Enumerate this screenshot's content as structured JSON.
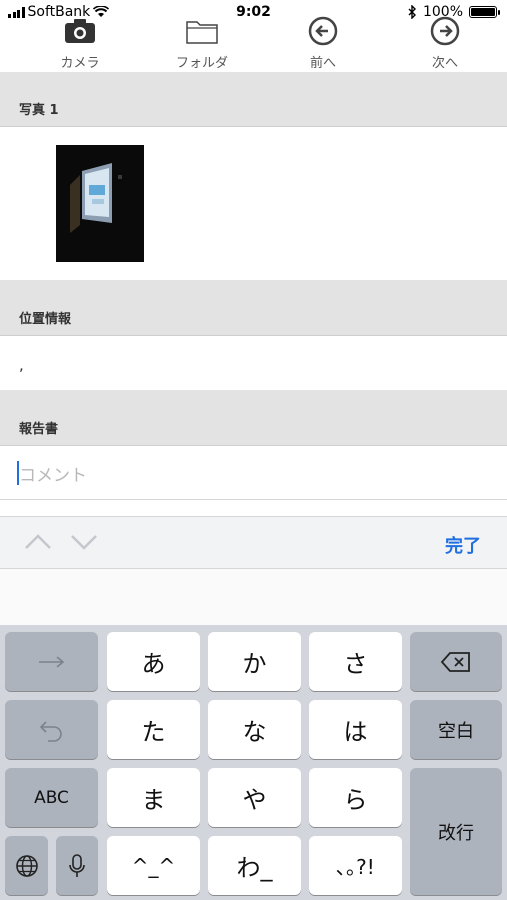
{
  "status": {
    "carrier": "SoftBank",
    "time": "9:02",
    "battery": "100%"
  },
  "toolbar": {
    "camera": "カメラ",
    "folder": "フォルダ",
    "prev": "前へ",
    "next": "次へ"
  },
  "sections": {
    "photo_title": "写真 1",
    "location_title": "位置情報",
    "location_value": ",",
    "report_title": "報告書",
    "comment_placeholder": "コメント"
  },
  "accessory": {
    "done": "完了"
  },
  "keyboard": {
    "row1": [
      "あ",
      "か",
      "さ"
    ],
    "row2": [
      "た",
      "な",
      "は"
    ],
    "row3": [
      "ま",
      "や",
      "ら"
    ],
    "row4": [
      "^_^",
      "わ_",
      "､｡?!"
    ],
    "space": "空白",
    "abc": "ABC",
    "return": "改行"
  },
  "colors": {
    "accent": "#1f6fe0",
    "section_bg": "#e3e3e3",
    "keyboard_bg": "#d2d5db"
  }
}
